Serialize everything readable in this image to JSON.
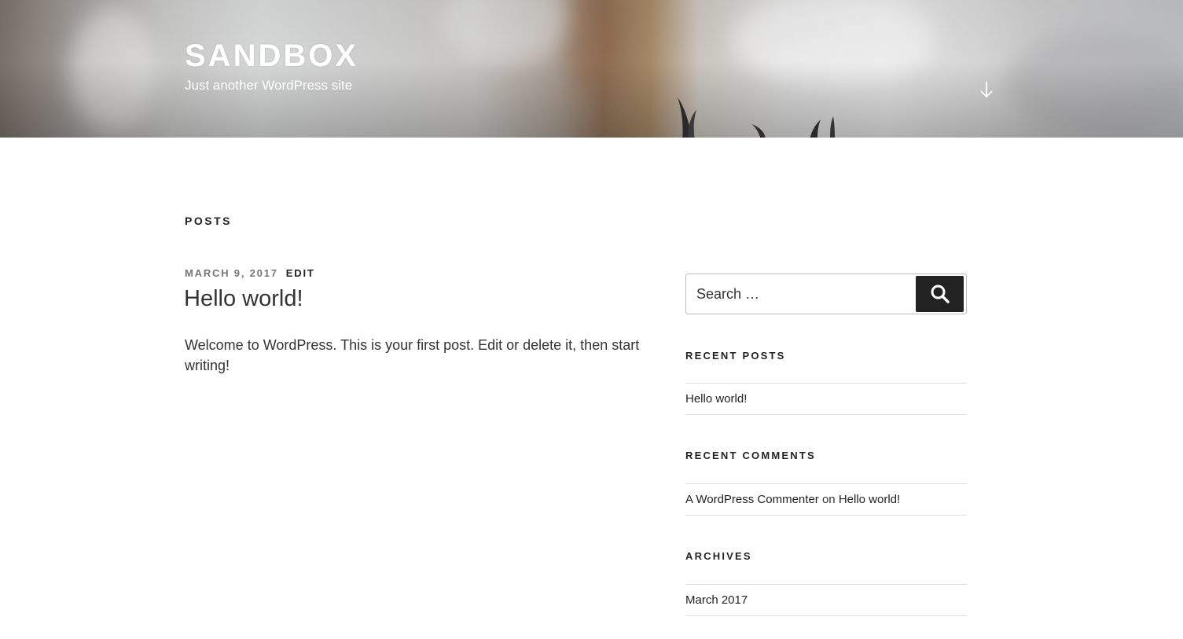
{
  "header": {
    "site_title": "SANDBOX",
    "site_description": "Just another WordPress site",
    "scroll_icon": "arrow-down-icon"
  },
  "main": {
    "page_heading": "POSTS",
    "post": {
      "date": "MARCH 9, 2017",
      "edit_label": "EDIT",
      "title": "Hello world!",
      "excerpt": "Welcome to WordPress. This is your first post. Edit or delete it, then start writing!"
    }
  },
  "sidebar": {
    "search": {
      "placeholder": "Search …",
      "icon": "search-icon"
    },
    "recent_posts": {
      "title": "RECENT POSTS",
      "items": [
        "Hello world!"
      ]
    },
    "recent_comments": {
      "title": "RECENT COMMENTS",
      "items": [
        {
          "author": "A WordPress Commenter",
          "connector": "on",
          "post": "Hello world!"
        }
      ]
    },
    "archives": {
      "title": "ARCHIVES",
      "items": [
        "March 2017"
      ]
    }
  },
  "colors": {
    "text": "#222222",
    "muted": "#767676",
    "button": "#222222",
    "divider": "#dddddd"
  }
}
